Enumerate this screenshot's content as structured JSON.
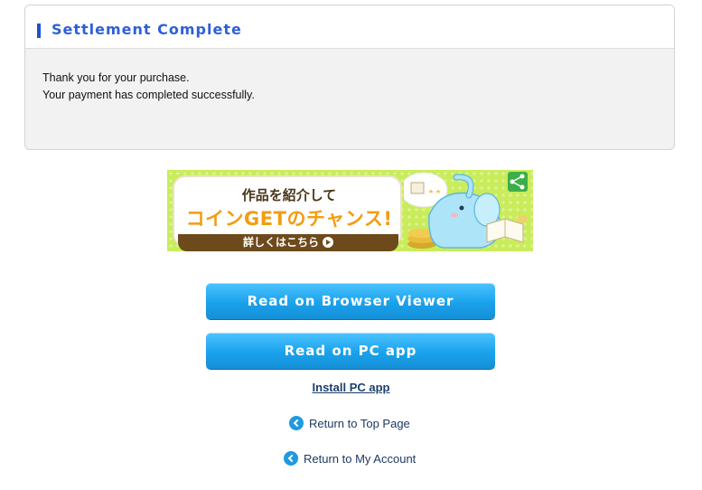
{
  "settlement": {
    "title": "Settlement Complete",
    "message_line1": "Thank you for your purchase.",
    "message_line2": "Your payment has completed successfully."
  },
  "banner": {
    "line1": "作品を紹介して",
    "line2": "コインGETのチャンス!",
    "line3": "詳しくはこちら"
  },
  "actions": {
    "browser_viewer_label": "Read on Browser Viewer",
    "pc_app_label": "Read on PC app",
    "install_label": "Install PC app",
    "top_page_label": "Return to Top Page",
    "my_account_label": "Return to My Account"
  },
  "colors": {
    "title_blue": "#2f5fd8",
    "button_blue": "#1aa2ec",
    "banner_green": "#c9ec5a",
    "banner_orange": "#f29d12"
  },
  "icons": {
    "nav": "chevron-left-circle-icon",
    "banner_play": "play-circle-icon",
    "banner_share": "share-icon"
  }
}
